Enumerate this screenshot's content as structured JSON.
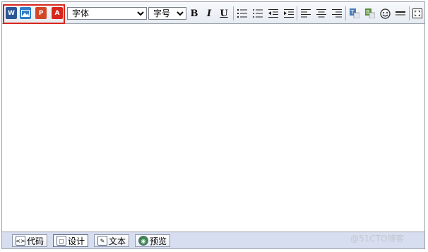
{
  "toolbar": {
    "office_buttons": [
      {
        "icon": "word-icon",
        "letter": "W",
        "color": "#2b5797"
      },
      {
        "icon": "image-icon",
        "letter": "",
        "color": "#2f7fc6"
      },
      {
        "icon": "powerpoint-icon",
        "letter": "P",
        "color": "#d24726"
      },
      {
        "icon": "pdf-icon",
        "letter": "A",
        "color": "#d9261c"
      }
    ],
    "font_select": {
      "value": "字体"
    },
    "size_select": {
      "value": "字号"
    },
    "bold_label": "B",
    "italic_label": "I",
    "underline_label": "U",
    "highlight_color": "#d9261c"
  },
  "modes": [
    {
      "label": "代码",
      "icon": "code-icon"
    },
    {
      "label": "设计",
      "icon": "design-icon",
      "active": true
    },
    {
      "label": "文本",
      "icon": "text-icon"
    },
    {
      "label": "预览",
      "icon": "preview-icon"
    }
  ],
  "watermark": "@51CTO博客"
}
